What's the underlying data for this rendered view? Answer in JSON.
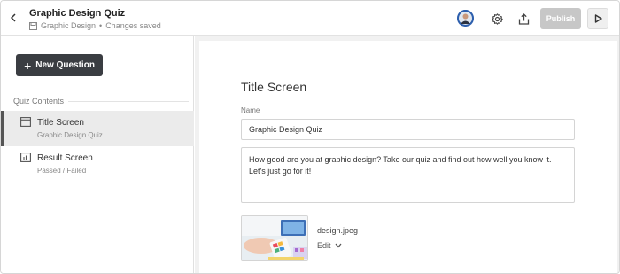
{
  "header": {
    "title": "Graphic Design Quiz",
    "category": "Graphic Design",
    "separator": "•",
    "status": "Changes saved",
    "publish_label": "Publish"
  },
  "sidebar": {
    "new_question_label": "New Question",
    "contents_header": "Quiz Contents",
    "items": [
      {
        "label": "Title Screen",
        "sub": "Graphic Design Quiz",
        "icon": "screen-icon"
      },
      {
        "label": "Result Screen",
        "sub": "Passed / Failed",
        "icon": "chart-icon"
      }
    ]
  },
  "main": {
    "screen_title": "Title Screen",
    "name_label": "Name",
    "name_value": "Graphic Design Quiz",
    "description": "How good are you at graphic design? Take our quiz and find out how well you know it. Let's just go for it!",
    "image_file": "design.jpeg",
    "edit_label": "Edit"
  },
  "colors": {
    "primary_button": "#3a3d42",
    "publish_disabled": "#c7c7c7",
    "main_bg": "#f1f1f1",
    "active_item": "#ebebeb"
  }
}
